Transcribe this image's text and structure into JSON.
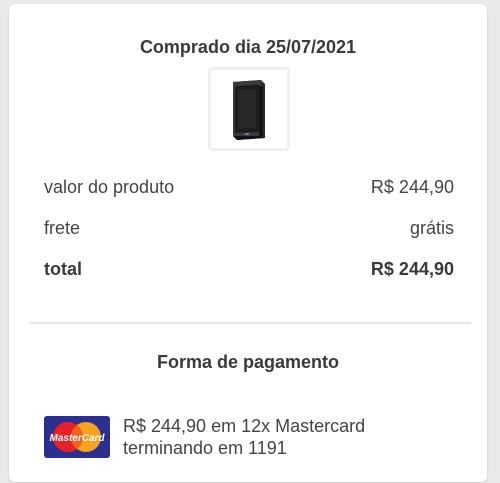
{
  "purchase": {
    "title": "Comprado dia 25/07/2021",
    "product_image": "pc-case-thumbnail"
  },
  "summary": {
    "product_label": "valor do produto",
    "product_value": "R$ 244,90",
    "shipping_label": "frete",
    "shipping_value": "grátis",
    "total_label": "total",
    "total_value": "R$ 244,90"
  },
  "payment": {
    "title": "Forma de pagamento",
    "card_brand": "MasterCard",
    "line1": "R$ 244,90 em 12x Mastercard",
    "line2": "terminando em 1191"
  },
  "colors": {
    "mastercard_bg": "#2b2f8f",
    "mastercard_red": "#e8202a",
    "mastercard_yellow": "#f7a21b"
  }
}
